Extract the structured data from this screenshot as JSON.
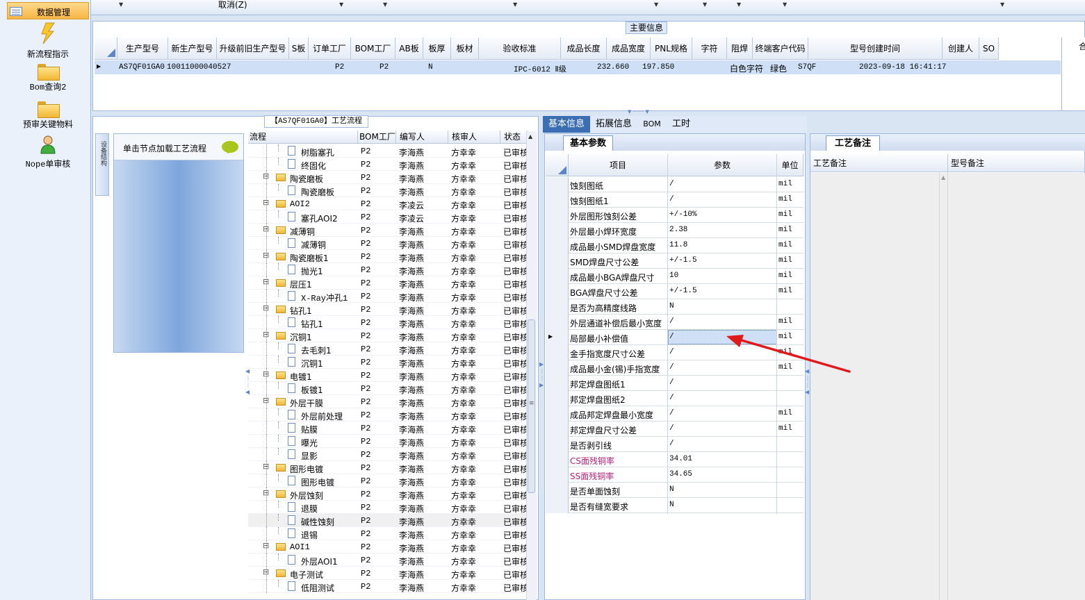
{
  "nav": {
    "header": "数据管理",
    "items": [
      {
        "label": "新流程指示",
        "icon": "lightning-icon"
      },
      {
        "label": "Bom查询2",
        "icon": "folder-icon"
      },
      {
        "label": "预审关键物料",
        "icon": "folder-icon"
      },
      {
        "label": "Nope单审核",
        "icon": "user-icon"
      }
    ]
  },
  "topbar": {
    "cancel": "取消(Z)"
  },
  "main_info": {
    "title": "主要信息",
    "columns": [
      "生产型号",
      "新生产型号",
      "升级前旧生产型号",
      "S板",
      "订单工厂",
      "BOM工厂",
      "AB板",
      "板厚",
      "板材",
      "验收标准",
      "成品长度",
      "成品宽度",
      "PNL规格",
      "字符",
      "阻焊",
      "终端客户代码",
      "型号创建时间",
      "创建人",
      "SO"
    ],
    "row": {
      "model": "AS7QF01GA0",
      "new_model": "10011000040527",
      "old_model": "",
      "s_board": "",
      "order_factory": "P2",
      "bom_factory": "P2",
      "ab_board": "N",
      "thickness": "",
      "material": "",
      "standard": "IPC-6012 Ⅱ级",
      "length": "232.660",
      "width": "197.850",
      "pnl": "",
      "char": "白色字符",
      "solder": "绿色",
      "customer": "S7QF",
      "created": "2023-09-18 16:41:17",
      "creator": "",
      "so": ""
    }
  },
  "process": {
    "title": "【AS7QF01GA0】工艺流程",
    "side_tab": "设备结构",
    "load_hint": "单击节点加载工艺流程",
    "columns": [
      "流程",
      "BOM工厂",
      "编写人",
      "核审人",
      "状态"
    ],
    "rows": [
      {
        "name": "树脂塞孔",
        "level": 2,
        "bom": "P2",
        "writer": "李海燕",
        "reviewer": "方幸幸",
        "status": "已审核"
      },
      {
        "name": "终固化",
        "level": 2,
        "bom": "P2",
        "writer": "李海燕",
        "reviewer": "方幸幸",
        "status": "已审核"
      },
      {
        "name": "陶瓷磨板",
        "level": 1,
        "bom": "P2",
        "writer": "李海燕",
        "reviewer": "方幸幸",
        "status": "已审核"
      },
      {
        "name": "陶瓷磨板",
        "level": 2,
        "bom": "P2",
        "writer": "李海燕",
        "reviewer": "方幸幸",
        "status": "已审核"
      },
      {
        "name": "AOI2",
        "level": 1,
        "bom": "P2",
        "writer": "李凌云",
        "reviewer": "方幸幸",
        "status": "已审核"
      },
      {
        "name": "塞孔AOI2",
        "level": 2,
        "bom": "P2",
        "writer": "李凌云",
        "reviewer": "方幸幸",
        "status": "已审核"
      },
      {
        "name": "减薄铜",
        "level": 1,
        "bom": "P2",
        "writer": "李海燕",
        "reviewer": "方幸幸",
        "status": "已审核"
      },
      {
        "name": "减薄铜",
        "level": 2,
        "bom": "P2",
        "writer": "李海燕",
        "reviewer": "方幸幸",
        "status": "已审核"
      },
      {
        "name": "陶瓷磨板1",
        "level": 1,
        "bom": "P2",
        "writer": "李海燕",
        "reviewer": "方幸幸",
        "status": "已审核"
      },
      {
        "name": "抛光1",
        "level": 2,
        "bom": "P2",
        "writer": "李海燕",
        "reviewer": "方幸幸",
        "status": "已审核"
      },
      {
        "name": "层压1",
        "level": 1,
        "bom": "P2",
        "writer": "李海燕",
        "reviewer": "方幸幸",
        "status": "已审核"
      },
      {
        "name": "X-Ray冲孔1",
        "level": 2,
        "bom": "P2",
        "writer": "李海燕",
        "reviewer": "方幸幸",
        "status": "已审核"
      },
      {
        "name": "钻孔1",
        "level": 1,
        "bom": "P2",
        "writer": "李海燕",
        "reviewer": "方幸幸",
        "status": "已审核"
      },
      {
        "name": "钻孔1",
        "level": 2,
        "bom": "P2",
        "writer": "李海燕",
        "reviewer": "方幸幸",
        "status": "已审核"
      },
      {
        "name": "沉铜1",
        "level": 1,
        "bom": "P2",
        "writer": "李海燕",
        "reviewer": "方幸幸",
        "status": "已审核"
      },
      {
        "name": "去毛刺1",
        "level": 2,
        "bom": "P2",
        "writer": "李海燕",
        "reviewer": "方幸幸",
        "status": "已审核"
      },
      {
        "name": "沉铜1",
        "level": 2,
        "bom": "P2",
        "writer": "李海燕",
        "reviewer": "方幸幸",
        "status": "已审核"
      },
      {
        "name": "电镀1",
        "level": 1,
        "bom": "P2",
        "writer": "李海燕",
        "reviewer": "方幸幸",
        "status": "已审核"
      },
      {
        "name": "板镀1",
        "level": 2,
        "bom": "P2",
        "writer": "李海燕",
        "reviewer": "方幸幸",
        "status": "已审核"
      },
      {
        "name": "外层干膜",
        "level": 1,
        "bom": "P2",
        "writer": "李海燕",
        "reviewer": "方幸幸",
        "status": "已审核"
      },
      {
        "name": "外层前处理",
        "level": 2,
        "bom": "P2",
        "writer": "李海燕",
        "reviewer": "方幸幸",
        "status": "已审核"
      },
      {
        "name": "贴膜",
        "level": 2,
        "bom": "P2",
        "writer": "李海燕",
        "reviewer": "方幸幸",
        "status": "已审核"
      },
      {
        "name": "曝光",
        "level": 2,
        "bom": "P2",
        "writer": "李海燕",
        "reviewer": "方幸幸",
        "status": "已审核"
      },
      {
        "name": "显影",
        "level": 2,
        "bom": "P2",
        "writer": "李海燕",
        "reviewer": "方幸幸",
        "status": "已审核"
      },
      {
        "name": "图形电镀",
        "level": 1,
        "bom": "P2",
        "writer": "李海燕",
        "reviewer": "方幸幸",
        "status": "已审核"
      },
      {
        "name": "图形电镀",
        "level": 2,
        "bom": "P2",
        "writer": "李海燕",
        "reviewer": "方幸幸",
        "status": "已审核"
      },
      {
        "name": "外层蚀刻",
        "level": 1,
        "bom": "P2",
        "writer": "李海燕",
        "reviewer": "方幸幸",
        "status": "已审核"
      },
      {
        "name": "退膜",
        "level": 2,
        "bom": "P2",
        "writer": "李海燕",
        "reviewer": "方幸幸",
        "status": "已审核"
      },
      {
        "name": "碱性蚀刻",
        "level": 2,
        "bom": "P2",
        "writer": "李海燕",
        "reviewer": "方幸幸",
        "status": "已审核",
        "selected": true
      },
      {
        "name": "退锡",
        "level": 2,
        "bom": "P2",
        "writer": "李海燕",
        "reviewer": "方幸幸",
        "status": "已审核"
      },
      {
        "name": "AOI1",
        "level": 1,
        "bom": "P2",
        "writer": "李海燕",
        "reviewer": "方幸幸",
        "status": "已审核"
      },
      {
        "name": "外层AOI1",
        "level": 2,
        "bom": "P2",
        "writer": "李海燕",
        "reviewer": "方幸幸",
        "status": "已审核"
      },
      {
        "name": "电子测试",
        "level": 1,
        "bom": "P2",
        "writer": "李海燕",
        "reviewer": "方幸幸",
        "status": "已审核"
      },
      {
        "name": "低阻测试",
        "level": 2,
        "bom": "P2",
        "writer": "李海燕",
        "reviewer": "方幸幸",
        "status": "已审核"
      }
    ]
  },
  "tabs": [
    "基本信息",
    "拓展信息",
    "BOM",
    "工时"
  ],
  "params": {
    "subtab": "基本参数",
    "columns": [
      "项目",
      "参数",
      "单位"
    ],
    "rows": [
      {
        "item": "蚀刻图纸",
        "value": "/",
        "unit": "mil"
      },
      {
        "item": "蚀刻图纸1",
        "value": "/",
        "unit": "mil"
      },
      {
        "item": "外层图形蚀刻公差",
        "value": "+/-10%",
        "unit": "mil"
      },
      {
        "item": "外层最小焊环宽度",
        "value": "2.38",
        "unit": "mil"
      },
      {
        "item": "成品最小SMD焊盘宽度",
        "value": "11.8",
        "unit": "mil"
      },
      {
        "item": "SMD焊盘尺寸公差",
        "value": "+/-1.5",
        "unit": "mil"
      },
      {
        "item": "成品最小BGA焊盘尺寸",
        "value": "10",
        "unit": "mil"
      },
      {
        "item": "BGA焊盘尺寸公差",
        "value": "+/-1.5",
        "unit": "mil"
      },
      {
        "item": "是否为高精度线路",
        "value": "N",
        "unit": ""
      },
      {
        "item": "外层通道补偿后最小宽度",
        "value": "/",
        "unit": "mil"
      },
      {
        "item": "局部最小补偿值",
        "value": "/",
        "unit": "mil",
        "selected": true
      },
      {
        "item": "金手指宽度尺寸公差",
        "value": "/",
        "unit": "mil"
      },
      {
        "item": "成品最小金(锡)手指宽度",
        "value": "/",
        "unit": "mil"
      },
      {
        "item": "邦定焊盘图纸1",
        "value": "/",
        "unit": ""
      },
      {
        "item": "邦定焊盘图纸2",
        "value": "/",
        "unit": ""
      },
      {
        "item": "成品邦定焊盘最小宽度",
        "value": "/",
        "unit": "mil"
      },
      {
        "item": "邦定焊盘尺寸公差",
        "value": "/",
        "unit": "mil"
      },
      {
        "item": "是否剥引线",
        "value": "/",
        "unit": ""
      },
      {
        "item": "CS面残铜率",
        "value": "34.01",
        "unit": "",
        "pink": true
      },
      {
        "item": "SS面残铜率",
        "value": "34.65",
        "unit": "",
        "pink": true
      },
      {
        "item": "是否单面蚀刻",
        "value": "N",
        "unit": ""
      },
      {
        "item": "是否有缝宽要求",
        "value": "N",
        "unit": ""
      }
    ]
  },
  "notes": {
    "tab": "工艺备注",
    "columns": [
      "工艺备注",
      "型号备注"
    ]
  },
  "colors": {
    "accent": "#3c6eb4",
    "selection": "#cfe0f6",
    "arrow": "#e0191a",
    "pink": "#b0207a"
  }
}
